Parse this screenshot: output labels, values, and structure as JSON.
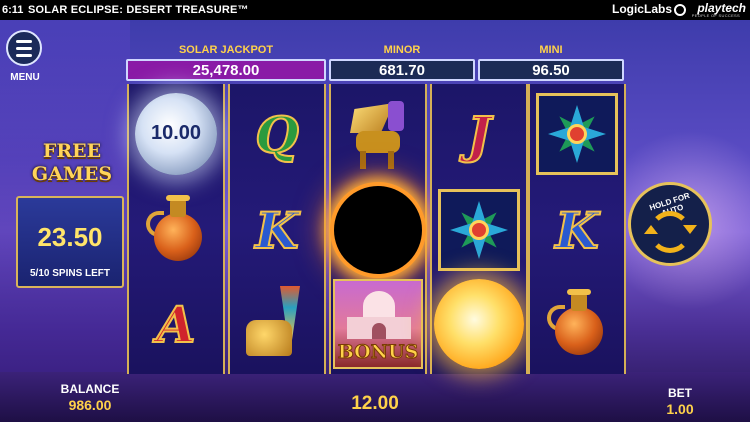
{
  "status_bar": {
    "clock": "6:11",
    "game_title": "SOLAR ECLIPSE: DESERT TREASURE™",
    "brand_primary": "LogicLabs",
    "brand_secondary": "playtech",
    "brand_secondary_tagline": "PEOPLE OF SUCCESS"
  },
  "menu": {
    "label": "MENU",
    "icon": "hamburger-icon"
  },
  "free_games": {
    "title_line1": "FREE",
    "title_line2": "GAMES",
    "win_amount": "23.50",
    "spins_left": "5/10 SPINS LEFT"
  },
  "jackpots": [
    {
      "label": "SOLAR JACKPOT",
      "value": "25,478.00",
      "color": "#8a1aa6"
    },
    {
      "label": "MINOR",
      "value": "681.70",
      "color": "#1c2a55"
    },
    {
      "label": "MINI",
      "value": "96.50",
      "color": "#1c2a55"
    }
  ],
  "reels": [
    {
      "symbols": [
        "moon",
        "vase",
        "A"
      ],
      "moon_value": "10.00"
    },
    {
      "symbols": [
        "Q",
        "K",
        "horn-sphinx"
      ]
    },
    {
      "symbols": [
        "lamassu",
        "eclipse",
        "bonus"
      ],
      "bonus_label": "BONUS"
    },
    {
      "symbols": [
        "J",
        "star-tile",
        "sun"
      ]
    },
    {
      "symbols": [
        "star-tile",
        "K",
        "vase"
      ]
    }
  ],
  "autoplay": {
    "label": "HOLD FOR AUTO",
    "icon": "rotate-arrows-icon"
  },
  "footer": {
    "balance_label": "BALANCE",
    "balance_value": "986.00",
    "win_value": "12.00",
    "bet_label": "BET",
    "bet_value": "1.00"
  },
  "colors": {
    "gold": "#ffd24a",
    "frame": "#d5b056",
    "reel_bg": "#1c1668",
    "sky": "#5b4cc4"
  }
}
